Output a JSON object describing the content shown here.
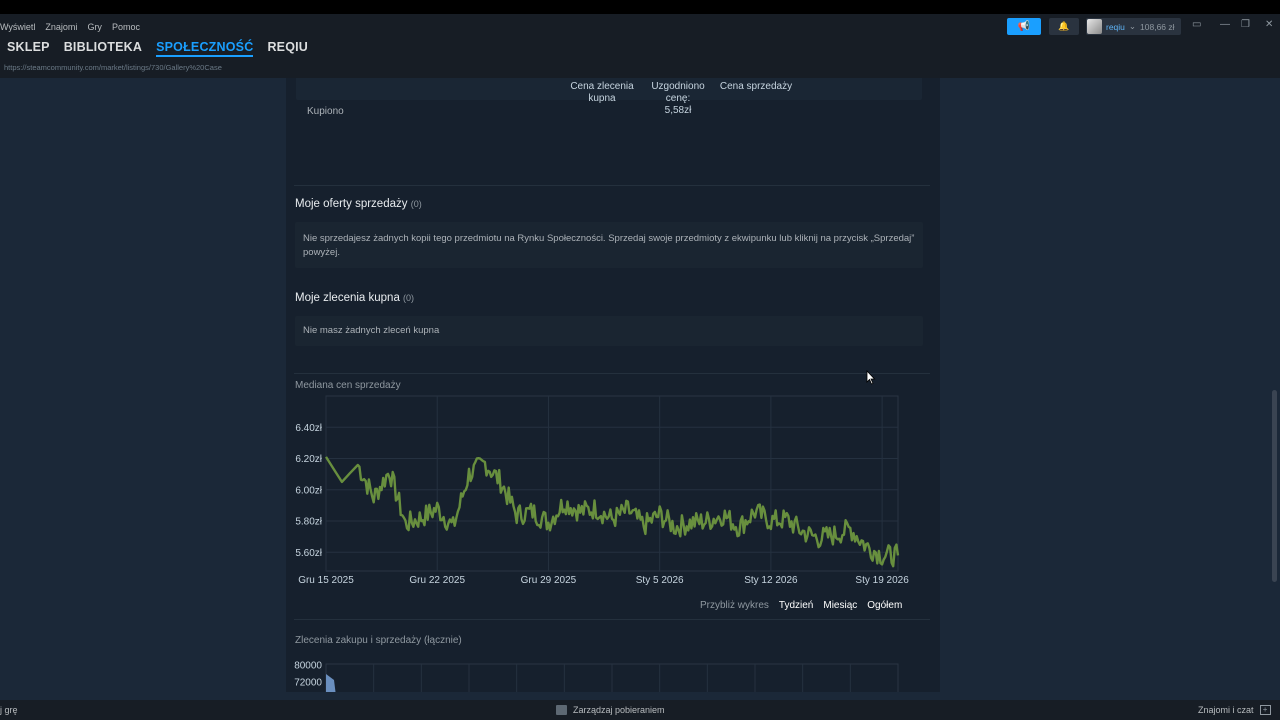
{
  "menu": [
    "Wyświetl",
    "Znajomi",
    "Gry",
    "Pomoc"
  ],
  "nav": {
    "store": "SKLEP",
    "library": "BIBLIOTEKA",
    "community": "SPOŁECZNOŚĆ",
    "profile": "REQIU"
  },
  "url": "https://steamcommunity.com/market/listings/730/Gallery%20Case",
  "user": {
    "name": "reqiu",
    "caret": "⌄",
    "balance": "108,66 zł"
  },
  "summary": {
    "buy_order_price": "Cena zlecenia\nkupna",
    "agreed_price_label": "Uzgodniono\ncenę:",
    "agreed_price_value": "5,58zł",
    "sell_price": "Cena sprzedaży",
    "bought": "Kupiono"
  },
  "sell_offers": {
    "title": "Moje oferty sprzedaży",
    "count": "(0)",
    "message": "Nie sprzedajesz żadnych kopii tego przedmiotu na Rynku Społeczności. Sprzedaj swoje przedmioty z ekwipunku lub kliknij na przycisk „Sprzedaj” powyżej."
  },
  "buy_orders": {
    "title": "Moje zlecenia kupna",
    "count": "(0)",
    "message": "Nie masz żadnych zleceń kupna"
  },
  "zoom": {
    "label": "Przybliż wykres",
    "week": "Tydzień",
    "month": "Miesiąc",
    "all": "Ogółem"
  },
  "chart_data": [
    {
      "type": "line",
      "title": "Mediana cen sprzedaży",
      "xlabel": "",
      "ylabel": "",
      "x_ticks": [
        "Gru 15 2025",
        "Gru 22 2025",
        "Gru 29 2025",
        "Sty 5 2026",
        "Sty 12 2026",
        "Sty 19 2026"
      ],
      "y_ticks": [
        "5.60zł",
        "5.80zł",
        "6.00zł",
        "6.20zł",
        "6.40zł"
      ],
      "ylim": [
        5.48,
        6.6
      ],
      "grid": true,
      "color": "#688f3e",
      "series": [
        {
          "x": [
            "2025-12-15",
            "2025-12-16",
            "2025-12-17",
            "2025-12-18",
            "2025-12-19",
            "2025-12-20",
            "2025-12-21",
            "2025-12-22",
            "2025-12-23",
            "2025-12-24",
            "2025-12-25",
            "2025-12-26",
            "2025-12-27",
            "2025-12-28",
            "2025-12-29",
            "2025-12-30",
            "2025-12-31",
            "2026-01-01",
            "2026-01-02",
            "2026-01-03",
            "2026-01-04",
            "2026-01-05",
            "2026-01-06",
            "2026-01-07",
            "2026-01-08",
            "2026-01-09",
            "2026-01-10",
            "2026-01-11",
            "2026-01-12",
            "2026-01-13",
            "2026-01-14",
            "2026-01-15",
            "2026-01-16",
            "2026-01-17",
            "2026-01-18",
            "2026-01-19",
            "2026-01-20"
          ],
          "values": [
            6.21,
            6.05,
            6.16,
            5.95,
            6.12,
            5.78,
            5.82,
            5.88,
            5.76,
            6.1,
            6.17,
            6.05,
            5.84,
            5.86,
            5.79,
            5.92,
            5.86,
            5.88,
            5.81,
            5.87,
            5.77,
            5.84,
            5.76,
            5.79,
            5.8,
            5.84,
            5.76,
            5.86,
            5.8,
            5.81,
            5.73,
            5.69,
            5.71,
            5.75,
            5.64,
            5.58,
            5.58
          ]
        }
      ]
    },
    {
      "type": "area",
      "title": "Zlecenia zakupu i sprzedaży (łącznie)",
      "y_ticks": [
        "72000",
        "80000"
      ],
      "color": "#6a8fbf"
    }
  ],
  "bottom": {
    "left": "j grę",
    "center": "Zarządzaj pobieraniem",
    "right": "Znajomi i czat"
  }
}
